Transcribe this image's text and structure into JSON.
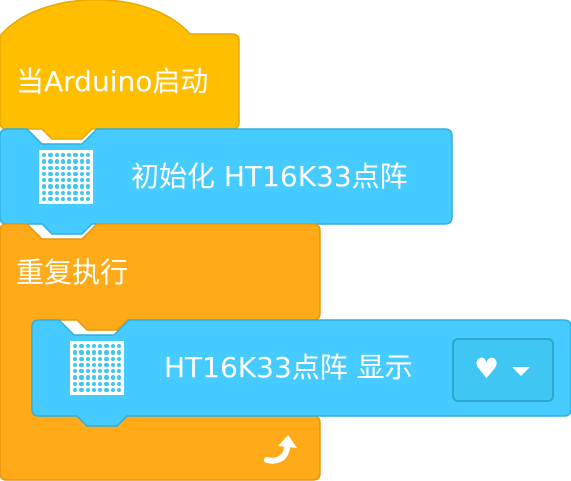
{
  "blocks": {
    "hat": {
      "label": "当Arduino启动",
      "color": "#FFBF00"
    },
    "init": {
      "label": "初始化 HT16K33点阵",
      "icon": "led-matrix-icon",
      "color": "#45CBFF"
    },
    "forever": {
      "label": "重复执行",
      "color": "#FFAB19",
      "end_icon": "loop-arrow-icon"
    },
    "display": {
      "label": "HT16K33点阵 显示",
      "icon": "led-matrix-icon",
      "color": "#45CBFF",
      "dropdown": {
        "selected": "♥",
        "icon": "chevron-down-icon"
      }
    }
  }
}
